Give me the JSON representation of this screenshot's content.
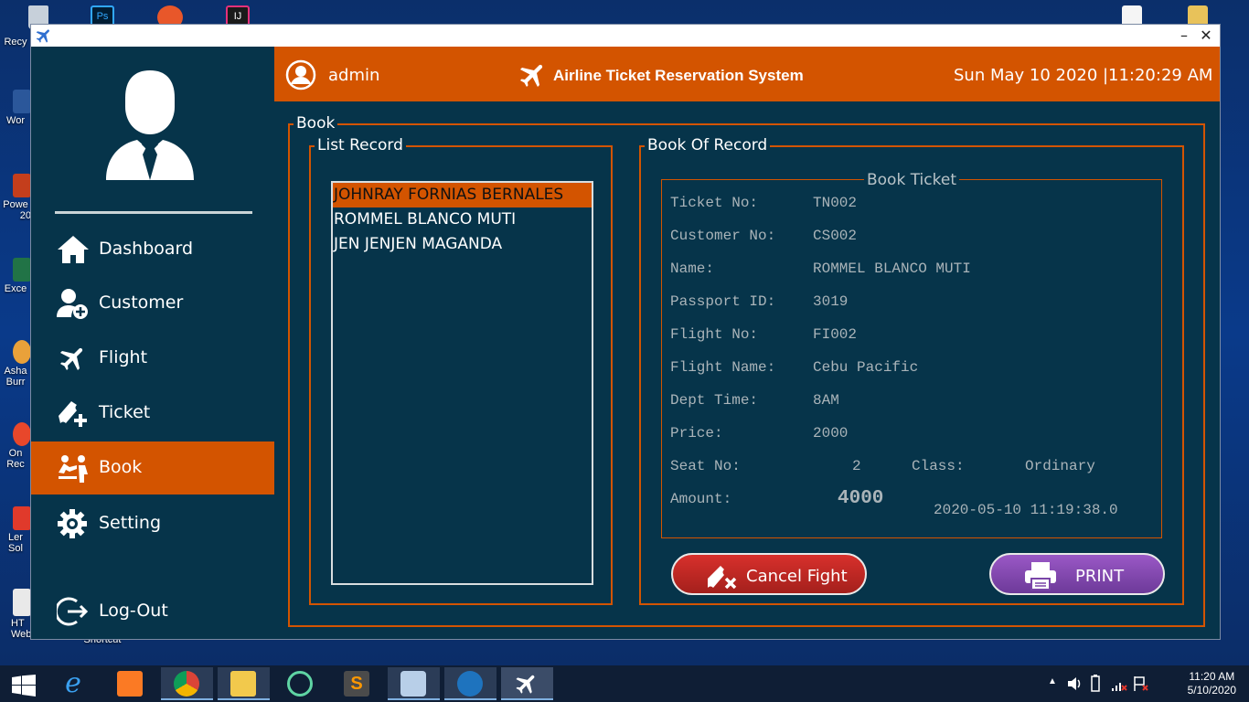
{
  "desktop": {
    "icons": [
      {
        "label": "Recy",
        "color": "#a8b4c2"
      },
      {
        "label": "Wor",
        "color": "#2b579a"
      },
      {
        "label": "Powe",
        "color": "#c43e1c"
      },
      {
        "label": "20",
        "color": "#c43e1c"
      },
      {
        "label": "Exce",
        "color": "#217346"
      },
      {
        "label": "Asha",
        "color": "#f0f0f0"
      },
      {
        "label": "Burr",
        "color": "#f0f0f0"
      },
      {
        "label": "On",
        "color": "#e8472b"
      },
      {
        "label": "Rec",
        "color": "#e8472b"
      },
      {
        "label": "Ler",
        "color": "#f0f0f0"
      },
      {
        "label": "Sol",
        "color": "#f0f0f0"
      },
      {
        "label": "HT",
        "color": "#e9e9e9"
      },
      {
        "label": "Websit...",
        "color": "#e9e9e9"
      },
      {
        "label": "Shortcut",
        "color": "#e9e9e9"
      }
    ],
    "top_icons": [
      "photoshop-icon",
      "paint-icon",
      "intellij-icon",
      "text-file-icon",
      "folder-icon"
    ]
  },
  "window": {
    "minimize": "–",
    "close": "✕"
  },
  "header": {
    "username": "admin",
    "title": "Airline Ticket Reservation System",
    "date": "Sun May 10 2020 |",
    "time": "11:20:29 AM"
  },
  "sidebar": {
    "items": [
      {
        "label": "Dashboard",
        "icon": "home-icon"
      },
      {
        "label": "Customer",
        "icon": "add-user-icon"
      },
      {
        "label": "Flight",
        "icon": "plane-icon"
      },
      {
        "label": "Ticket",
        "icon": "ticket-plus-icon"
      },
      {
        "label": "Book",
        "icon": "book-people-icon",
        "active": true
      },
      {
        "label": "Setting",
        "icon": "gear-icon"
      },
      {
        "label": "Log-Out",
        "icon": "logout-icon"
      }
    ]
  },
  "book": {
    "legend": "Book",
    "list_legend": "List Record",
    "records": [
      "JOHNRAY FORNIAS BERNALES",
      "ROMMEL BLANCO MUTI",
      "JEN JENJEN MAGANDA"
    ],
    "selected_index": 0,
    "record_legend": "Book Of Record",
    "ticket_legend": "Book Ticket",
    "fields": {
      "ticket_no_label": "Ticket No:",
      "ticket_no": "TN002",
      "customer_no_label": "Customer No:",
      "customer_no": "CS002",
      "name_label": "Name:",
      "name": "ROMMEL BLANCO MUTI",
      "passport_label": "Passport ID:",
      "passport": "3019",
      "flight_no_label": "Flight No:",
      "flight_no": "FI002",
      "flight_name_label": "Flight Name:",
      "flight_name": "Cebu Pacific",
      "dept_label": "Dept Time:",
      "dept": "8AM",
      "price_label": "Price:",
      "price": "2000",
      "seat_label": "Seat No:",
      "seat": "2",
      "class_label": "Class:",
      "class": "Ordinary",
      "amount_label": "Amount:",
      "amount": "4000",
      "timestamp": "2020-05-10 11:19:38.0"
    },
    "cancel_label": "Cancel Fight",
    "print_label": "PRINT"
  },
  "taskbar": {
    "apps": [
      "windows-start-icon",
      "internet-explorer-icon",
      "xampp-icon",
      "chrome-icon",
      "file-explorer-icon",
      "atom-icon",
      "sublime-text-icon",
      "virtualbox-icon",
      "mysql-workbench-icon",
      "airline-app-icon"
    ],
    "clock_time": "11:20 AM",
    "clock_date": "5/10/2020"
  },
  "colors": {
    "accent": "#d35400",
    "panel": "#06344a",
    "cancel": "#b8241f",
    "print": "#8147ad"
  }
}
